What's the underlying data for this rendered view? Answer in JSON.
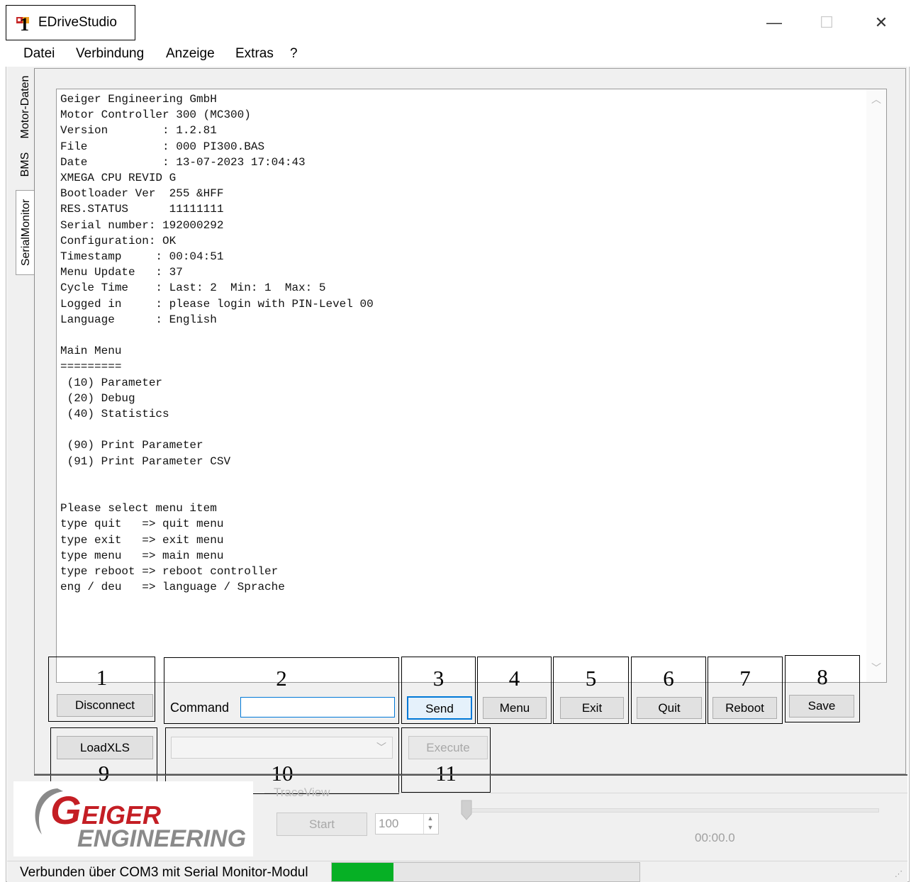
{
  "window": {
    "title": "EDriveStudio",
    "title_annotation": "1",
    "controls": {
      "minimize": "—",
      "maximize": "☐",
      "close": "✕"
    }
  },
  "menubar": {
    "items": [
      {
        "label": "Datei"
      },
      {
        "label": "Verbindung"
      },
      {
        "label": "Anzeige"
      },
      {
        "label": "Extras"
      },
      {
        "label": "?"
      }
    ]
  },
  "tabs": {
    "items": [
      {
        "label": "Motor-Daten",
        "selected": false
      },
      {
        "label": "BMS",
        "selected": false
      },
      {
        "label": "SerialMonitor",
        "selected": true
      }
    ]
  },
  "terminal": {
    "lines": [
      "Geiger Engineering GmbH",
      "Motor Controller 300 (MC300)",
      "Version        : 1.2.81",
      "File           : 000 PI300.BAS",
      "Date           : 13-07-2023 17:04:43",
      "XMEGA CPU REVID G",
      "Bootloader Ver  255 &HFF",
      "RES.STATUS      11111111",
      "Serial number: 192000292",
      "Configuration: OK",
      "Timestamp     : 00:04:51",
      "Menu Update   : 37",
      "Cycle Time    : Last: 2  Min: 1  Max: 5",
      "Logged in     : please login with PIN-Level 00",
      "Language      : English",
      "",
      "Main Menu",
      "=========",
      " (10) Parameter",
      " (20) Debug",
      " (40) Statistics",
      "",
      " (90) Print Parameter",
      " (91) Print Parameter CSV",
      "",
      "",
      "Please select menu item",
      "type quit   => quit menu",
      "type exit   => exit menu",
      "type menu   => main menu",
      "type reboot => reboot controller",
      "eng / deu   => language / Sprache"
    ]
  },
  "controls": {
    "disconnect": {
      "label": "Disconnect",
      "annotation": "1"
    },
    "command": {
      "label": "Command",
      "value": "",
      "annotation": "2"
    },
    "send": {
      "label": "Send",
      "annotation": "3"
    },
    "menu": {
      "label": "Menu",
      "annotation": "4"
    },
    "exit": {
      "label": "Exit",
      "annotation": "5"
    },
    "quit": {
      "label": "Quit",
      "annotation": "6"
    },
    "reboot": {
      "label": "Reboot",
      "annotation": "7"
    },
    "save": {
      "label": "Save",
      "annotation": "8"
    },
    "loadxls": {
      "label": "LoadXLS",
      "annotation": "9"
    },
    "script_select": {
      "value": "",
      "annotation": "10"
    },
    "execute": {
      "label": "Execute",
      "annotation": "11"
    }
  },
  "logo": {
    "line1": "GEIGER",
    "line2": "ENGINEERING"
  },
  "traceview": {
    "label": "TraceView",
    "start_label": "Start",
    "interval_value": "100",
    "time": "00:00.0"
  },
  "status": {
    "text": "Verbunden über COM3 mit Serial Monitor-Modul",
    "progress": 0.2
  },
  "colors": {
    "accent": "#0078d7",
    "progress": "#06b025",
    "logo_red": "#c41e24",
    "logo_gray": "#8a8a8a"
  }
}
